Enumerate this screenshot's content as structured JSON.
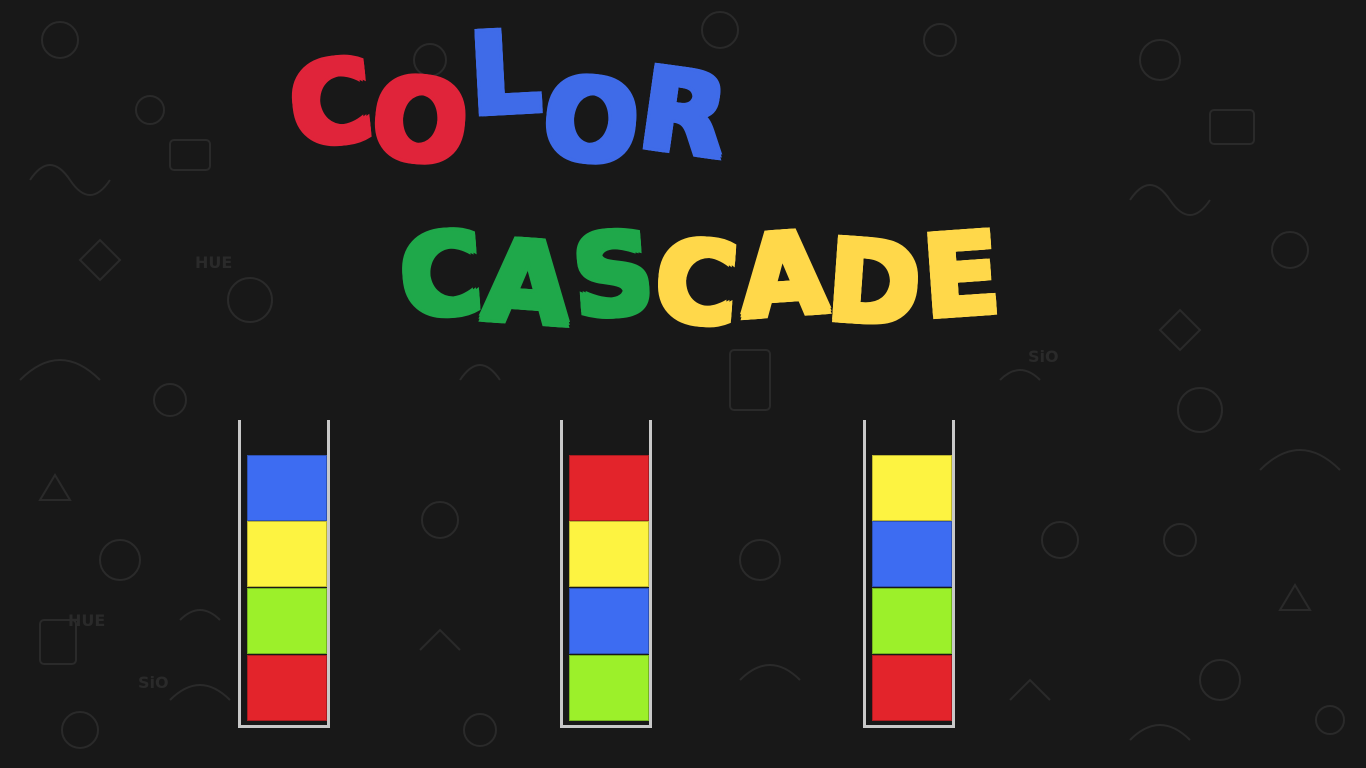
{
  "title": {
    "line1": [
      {
        "ch": "C",
        "color": "red"
      },
      {
        "ch": "O",
        "color": "red"
      },
      {
        "ch": "L",
        "color": "blue"
      },
      {
        "ch": "O",
        "color": "blue"
      },
      {
        "ch": "R",
        "color": "blue"
      }
    ],
    "line2": [
      {
        "ch": "C",
        "color": "green"
      },
      {
        "ch": "A",
        "color": "green"
      },
      {
        "ch": "S",
        "color": "green"
      },
      {
        "ch": "C",
        "color": "yellow"
      },
      {
        "ch": "A",
        "color": "yellow"
      },
      {
        "ch": "D",
        "color": "yellow"
      },
      {
        "ch": "E",
        "color": "yellow"
      }
    ]
  },
  "colors": {
    "background": "#181818",
    "red": "#e0243a",
    "blue": "#3f6be8",
    "green": "#1fa84a",
    "yellow": "#ffd84a",
    "block_red": "#e3242b",
    "block_blue": "#3d6cf2",
    "block_yellow": "#fdf341",
    "block_green": "#9cf02a",
    "tube_border": "#c8c8c8"
  },
  "tubes": [
    {
      "blocks": [
        "blue",
        "yellow",
        "green",
        "red"
      ]
    },
    {
      "blocks": [
        "red",
        "yellow",
        "blue",
        "green"
      ]
    },
    {
      "blocks": [
        "yellow",
        "blue",
        "green",
        "red"
      ]
    }
  ],
  "background_doodles": {
    "texts": [
      "HUE",
      "SiO",
      "HUE",
      "SiO"
    ]
  }
}
